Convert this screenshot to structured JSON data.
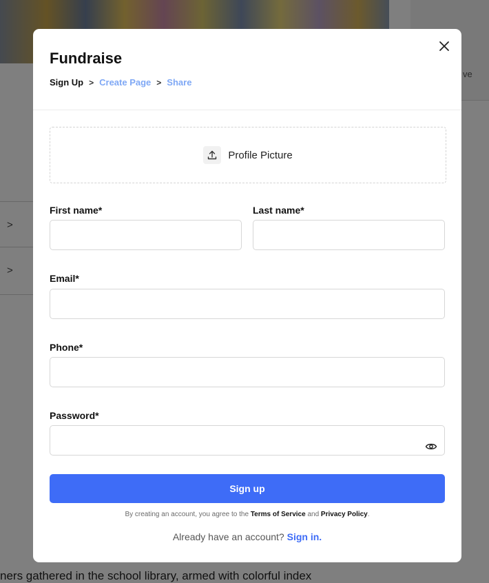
{
  "background": {
    "side_card_text": "ve",
    "chevron_1": ">",
    "chevron_2": ">",
    "body_text": "ners gathered in the school library, armed with colorful index"
  },
  "modal": {
    "title": "Fundraise",
    "close_icon": "close-icon",
    "steps": {
      "active": "Sign Up",
      "separator": ">",
      "step2": "Create Page",
      "step3": "Share"
    },
    "upload_label": "Profile Picture",
    "upload_icon": "upload-icon",
    "fields": {
      "first_name_label": "First name*",
      "first_name_value": "",
      "last_name_label": "Last name*",
      "last_name_value": "",
      "email_label": "Email*",
      "email_value": "",
      "phone_label": "Phone*",
      "phone_value": "",
      "password_label": "Password*",
      "password_value": ""
    },
    "signup_button": "Sign up",
    "terms_prefix": "By creating an account, you agree to the",
    "terms_link": "Terms of Service",
    "terms_and": "and",
    "privacy_link": "Privacy Policy",
    "terms_suffix": ".",
    "signin_prompt": "Already have an account?",
    "signin_link": "Sign in."
  },
  "colors": {
    "accent": "#3e6cf7",
    "step_link": "#7fa8f5",
    "overlay": "rgba(0,0,0,0.5)"
  }
}
